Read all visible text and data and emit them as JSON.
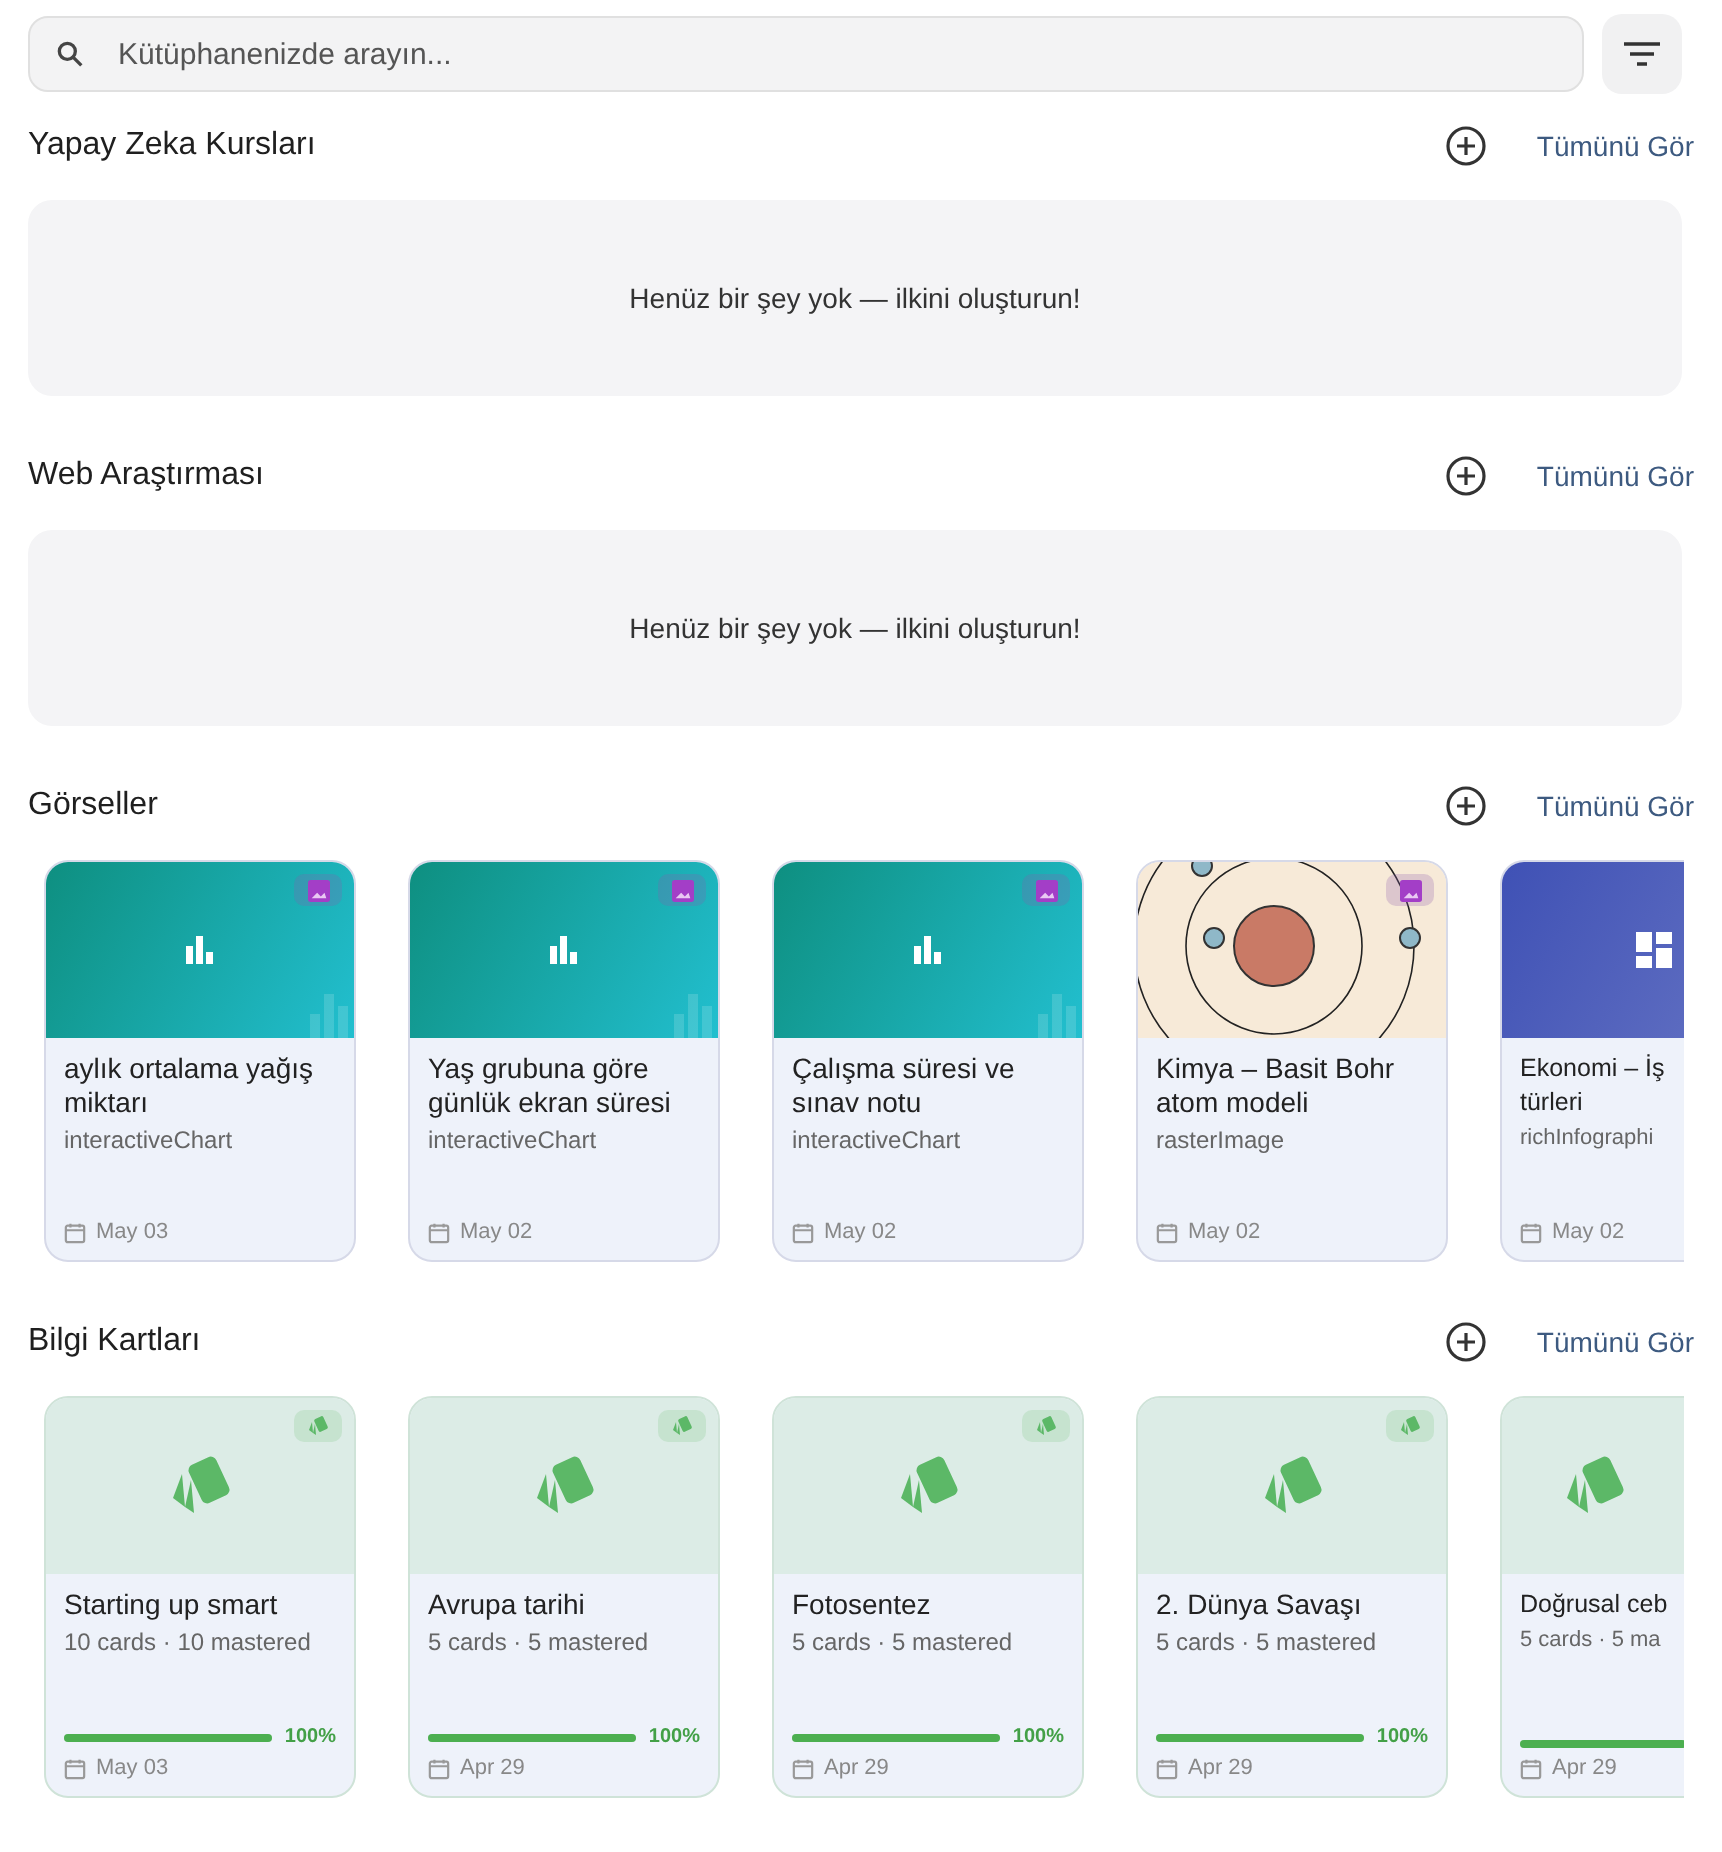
{
  "search": {
    "placeholder": "Kütüphanenizde arayın..."
  },
  "sections": [
    {
      "title": "Yapay Zeka Kursları",
      "see_all": "Tümünü Gör",
      "kind": "empty",
      "empty_text": "Henüz bir şey yok — ilkini oluşturun!"
    },
    {
      "title": "Web Araştırması",
      "see_all": "Tümünü Gör",
      "kind": "empty",
      "empty_text": "Henüz bir şey yok — ilkini oluşturun!"
    },
    {
      "title": "Görseller",
      "see_all": "Tümünü Gör",
      "kind": "visuals",
      "items": [
        {
          "kind": "chart",
          "title": "aylık ortalama yağış miktarı",
          "type": "interactiveChart",
          "date": "May 03"
        },
        {
          "kind": "chart",
          "title": "Yaş grubuna göre günlük ekran süresi",
          "type": "interactiveChart",
          "date": "May 02"
        },
        {
          "kind": "chart",
          "title": "Çalışma süresi ve sınav notu",
          "type": "interactiveChart",
          "date": "May 02"
        },
        {
          "kind": "picture",
          "title": "Kimya – Basit Bohr atom modeli",
          "type": "rasterImage",
          "date": "May 02"
        },
        {
          "kind": "infographic",
          "title": "Ekonomi – İş türleri",
          "type": "richInfographi",
          "date": "May 02",
          "clipped": true
        }
      ]
    },
    {
      "title": "Bilgi Kartları",
      "see_all": "Tümünü Gör",
      "kind": "flashcards",
      "items": [
        {
          "kind": "flashcards",
          "title": "Starting up smart",
          "type": "10 cards · 10 mastered",
          "level": 1,
          "percent": "100%",
          "date": "May 03"
        },
        {
          "kind": "flashcards",
          "title": "Avrupa tarihi",
          "type": "5 cards · 5 mastered",
          "level": 1,
          "percent": "100%",
          "date": "Apr 29"
        },
        {
          "kind": "flashcards",
          "title": "Fotosentez",
          "type": "5 cards · 5 mastered",
          "level": 1,
          "percent": "100%",
          "date": "Apr 29"
        },
        {
          "kind": "flashcards",
          "title": "2. Dünya Savaşı",
          "type": "5 cards · 5 mastered",
          "level": 1,
          "percent": "100%",
          "date": "Apr 29"
        },
        {
          "kind": "flashcards",
          "title": "Doğrusal ceb",
          "type": "5 cards · 5 ma",
          "level": 1,
          "date": "Apr 29",
          "clipped": true
        }
      ]
    }
  ]
}
